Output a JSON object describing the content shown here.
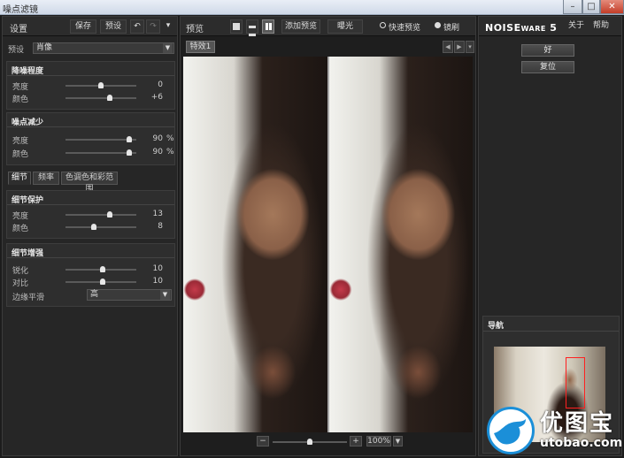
{
  "window": {
    "title": "噪点滤镜",
    "min": "–",
    "max": "□",
    "close": "✕"
  },
  "settings": {
    "title": "设置",
    "save": "保存",
    "preset": "预设",
    "undo": "↶",
    "redo": "↷",
    "menu": "▾",
    "preset_label": "预设",
    "preset_value": "肖像"
  },
  "noise_level": {
    "title": "降噪程度",
    "sliders": [
      {
        "label": "亮度",
        "value": "0",
        "unit": "",
        "pos": 0.5
      },
      {
        "label": "颜色",
        "value": "+6",
        "unit": "",
        "pos": 0.62
      }
    ]
  },
  "noise_reduction": {
    "title": "噪点减少",
    "sliders": [
      {
        "label": "亮度",
        "value": "90",
        "unit": "%",
        "pos": 0.9
      },
      {
        "label": "颜色",
        "value": "90",
        "unit": "%",
        "pos": 0.9
      }
    ]
  },
  "tabs": [
    "细节",
    "频率",
    "色调色和彩范围"
  ],
  "detail_protection": {
    "title": "细节保护",
    "sliders": [
      {
        "label": "亮度",
        "value": "13",
        "unit": "",
        "pos": 0.63
      },
      {
        "label": "颜色",
        "value": "8",
        "unit": "",
        "pos": 0.4
      }
    ]
  },
  "detail_enhance": {
    "title": "细节增强",
    "sliders": [
      {
        "label": "锐化",
        "value": "10",
        "unit": "",
        "pos": 0.52
      },
      {
        "label": "对比",
        "value": "10",
        "unit": "",
        "pos": 0.52
      }
    ],
    "edge_label": "边缘平滑",
    "edge_value": "高"
  },
  "preview": {
    "title": "预览",
    "add_preview": "添加预览",
    "exposure": "曝光",
    "fast_preview": "快速预览",
    "lens": "镜刷",
    "image_tab": "特效1",
    "zoom_minus": "−",
    "zoom_plus": "+",
    "zoom_level": "100%",
    "zoom_pos": 0.5
  },
  "right": {
    "brand": "NOISE",
    "brand_small": "WARE",
    "version": "5",
    "about": "关于",
    "help": "帮助",
    "ok": "好",
    "reset": "复位",
    "navigator": "导航"
  },
  "watermark": {
    "text": "优图宝",
    "url": "utobao.com"
  },
  "colors": {
    "accent_blue": "#1b8fd8",
    "nav_rect": "#ff2020"
  }
}
